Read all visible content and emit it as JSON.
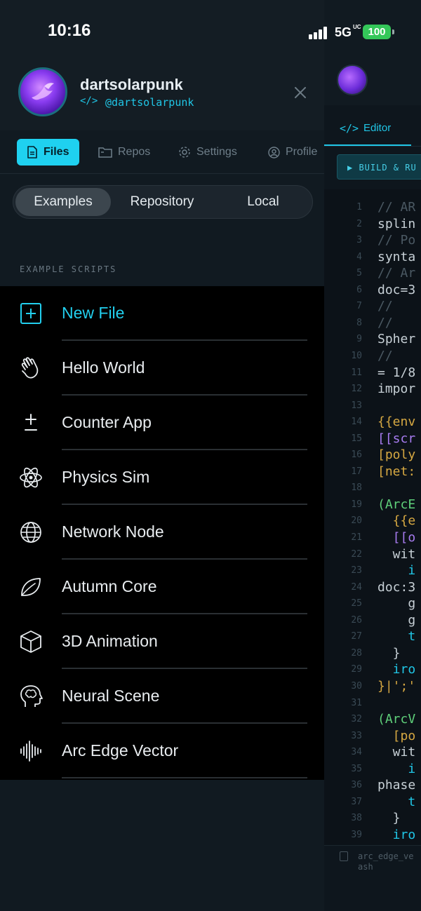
{
  "status_bar": {
    "time": "10:16",
    "network": "5G",
    "network_sub": "UC",
    "battery": "100"
  },
  "profile": {
    "name": "dartsolarpunk",
    "handle_icon": "</>",
    "handle": "@dartsolarpunk"
  },
  "nav_tabs": [
    {
      "label": "Files",
      "icon": "file-icon"
    },
    {
      "label": "Repos",
      "icon": "folder-icon"
    },
    {
      "label": "Settings",
      "icon": "gear-icon"
    },
    {
      "label": "Profile",
      "icon": "user-circle-icon"
    }
  ],
  "source_segments": [
    {
      "label": "Examples",
      "selected": true
    },
    {
      "label": "Repository",
      "selected": false
    },
    {
      "label": "Local",
      "selected": false
    }
  ],
  "section_title": "EXAMPLE SCRIPTS",
  "scripts": [
    {
      "label": "New File",
      "icon": "plus-square-icon"
    },
    {
      "label": "Hello World",
      "icon": "wave-hand-icon"
    },
    {
      "label": "Counter App",
      "icon": "plus-minus-icon"
    },
    {
      "label": "Physics Sim",
      "icon": "atom-icon"
    },
    {
      "label": "Network Node",
      "icon": "globe-icon"
    },
    {
      "label": "Autumn Core",
      "icon": "leaf-icon"
    },
    {
      "label": "3D Animation",
      "icon": "cube-icon"
    },
    {
      "label": "Neural Scene",
      "icon": "brain-head-icon"
    },
    {
      "label": "Arc Edge Vector",
      "icon": "waveform-icon"
    }
  ],
  "editor": {
    "tab_icon": "</>",
    "tab_label": "Editor",
    "build_label": "▶ BUILD & RU",
    "footer_file": "arc_edge_ve ash",
    "lines": [
      {
        "n": "1",
        "code": "// AR",
        "color": "#4b5963"
      },
      {
        "n": "2",
        "code": "splin",
        "color": "#c7d0d6"
      },
      {
        "n": "3",
        "code": "// Po",
        "color": "#4b5963"
      },
      {
        "n": "4",
        "code": "synta",
        "color": "#c7d0d6"
      },
      {
        "n": "5",
        "code": "// Ar",
        "color": "#4b5963"
      },
      {
        "n": "6",
        "code": "doc=3",
        "color": "#c7d0d6"
      },
      {
        "n": "7",
        "code": "//",
        "color": "#4b5963"
      },
      {
        "n": "8",
        "code": "//",
        "color": "#4b5963"
      },
      {
        "n": "9",
        "code": "Spher",
        "color": "#c7d0d6"
      },
      {
        "n": "10",
        "code": "//",
        "color": "#4b5963"
      },
      {
        "n": "11",
        "code": "= 1/8",
        "color": "#c7d0d6"
      },
      {
        "n": "12",
        "code": "impor",
        "color": "#c7d0d6"
      },
      {
        "n": "13",
        "code": "",
        "color": "#c7d0d6"
      },
      {
        "n": "14",
        "code": "{{env",
        "color": "#d6a842"
      },
      {
        "n": "15",
        "code": "[[scr",
        "color": "#a77cf0"
      },
      {
        "n": "16",
        "code": "[poly",
        "color": "#d6a842"
      },
      {
        "n": "17",
        "code": "[net:",
        "color": "#d6a842"
      },
      {
        "n": "18",
        "code": "",
        "color": "#c7d0d6"
      },
      {
        "n": "19",
        "code": "(ArcE",
        "color": "#5fd07a"
      },
      {
        "n": "20",
        "code": "  {{e",
        "color": "#d6a842"
      },
      {
        "n": "21",
        "code": "  [[o",
        "color": "#a77cf0"
      },
      {
        "n": "22",
        "code": "  wit",
        "color": "#c7d0d6"
      },
      {
        "n": "23",
        "code": "    i",
        "color": "#20c6e6"
      },
      {
        "n": "24",
        "code": "doc:3",
        "color": "#c7d0d6"
      },
      {
        "n": "25",
        "code": "    g",
        "color": "#c7d0d6"
      },
      {
        "n": "26",
        "code": "    g",
        "color": "#c7d0d6"
      },
      {
        "n": "27",
        "code": "    t",
        "color": "#20c6e6"
      },
      {
        "n": "28",
        "code": "  }",
        "color": "#c7d0d6"
      },
      {
        "n": "29",
        "code": "  iro",
        "color": "#20c6e6"
      },
      {
        "n": "30",
        "code": "}|';'",
        "color": "#d6a842"
      },
      {
        "n": "31",
        "code": "",
        "color": "#c7d0d6"
      },
      {
        "n": "32",
        "code": "(ArcV",
        "color": "#5fd07a"
      },
      {
        "n": "33",
        "code": "  [po",
        "color": "#d6a842"
      },
      {
        "n": "34",
        "code": "  wit",
        "color": "#c7d0d6"
      },
      {
        "n": "35",
        "code": "    i",
        "color": "#20c6e6"
      },
      {
        "n": "36",
        "code": "phase",
        "color": "#c7d0d6"
      },
      {
        "n": "37",
        "code": "    t",
        "color": "#20c6e6"
      },
      {
        "n": "38",
        "code": "  }",
        "color": "#c7d0d6"
      },
      {
        "n": "39",
        "code": "  iro",
        "color": "#20c6e6"
      }
    ]
  },
  "colors": {
    "accent": "#20c6e6",
    "drawer_bg": "#111a21",
    "list_bg": "#000000"
  }
}
